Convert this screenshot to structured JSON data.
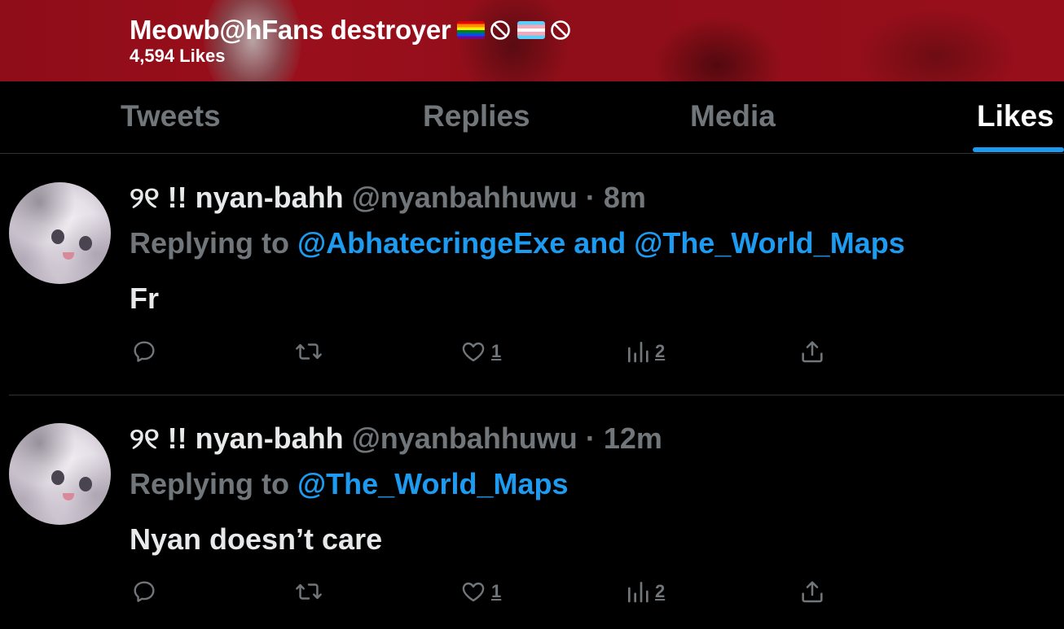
{
  "header": {
    "profile_name": "Meowb@hFans destroyer",
    "likes_count": "4,594 Likes",
    "accent_color": "#9a0f1c"
  },
  "tabs": [
    {
      "label": "Tweets",
      "active": false
    },
    {
      "label": "Replies",
      "active": false
    },
    {
      "label": "Media",
      "active": false
    },
    {
      "label": "Likes",
      "active": true
    }
  ],
  "colors": {
    "link": "#1d9bf0",
    "muted": "#71767b",
    "text": "#e7e9ea",
    "background": "#000000"
  },
  "tweets": [
    {
      "display_name": "୨୧ !! nyan-bahh",
      "handle": "@nyanbahhuwu",
      "separator": "·",
      "time": "8m",
      "replying_prefix": "Replying to",
      "mentions": "@AbhatecringeExe and @The_World_Maps",
      "text": "Fr",
      "likes": "1",
      "views": "2"
    },
    {
      "display_name": "୨୧ !! nyan-bahh",
      "handle": "@nyanbahhuwu",
      "separator": "·",
      "time": "12m",
      "replying_prefix": "Replying to",
      "mentions": "@The_World_Maps",
      "text": "Nyan doesn’t care",
      "likes": "1",
      "views": "2"
    }
  ],
  "icons": {
    "reply": "reply-icon",
    "retweet": "retweet-icon",
    "like": "heart-icon",
    "views": "views-icon",
    "share": "share-icon",
    "pride_flag": "rainbow-flag-icon",
    "trans_flag": "trans-flag-icon",
    "prohibited": "prohibited-icon"
  }
}
